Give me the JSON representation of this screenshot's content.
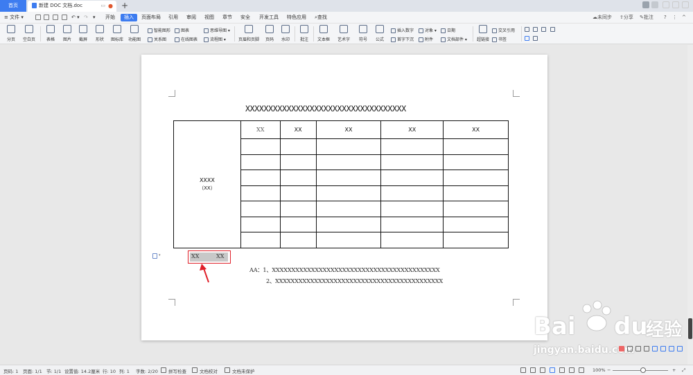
{
  "tabs": {
    "home": "首页",
    "doc": "新建 DOC 文档.doc",
    "add": "+"
  },
  "menu": {
    "file": "文件",
    "items": [
      "开始",
      "插入",
      "页面布局",
      "引用",
      "审阅",
      "视图",
      "章节",
      "安全",
      "开发工具",
      "特色应用"
    ],
    "search": "查找",
    "right": {
      "sync": "未同步",
      "share": "分享",
      "comment": "批注",
      "help": "?"
    }
  },
  "ribbon": {
    "large": [
      {
        "label": "分页",
        "icon": "page-break-icon"
      },
      {
        "label": "空白页",
        "icon": "blank-page-icon"
      },
      {
        "label": "表格",
        "icon": "table-icon"
      },
      {
        "label": "图片",
        "icon": "picture-icon"
      },
      {
        "label": "截屏",
        "icon": "screenshot-icon"
      },
      {
        "label": "形状",
        "icon": "shape-icon"
      },
      {
        "label": "图标库",
        "icon": "icon-library-icon"
      },
      {
        "label": "功能图",
        "icon": "function-chart-icon"
      },
      {
        "label": "页眉和页脚",
        "icon": "header-footer-icon"
      },
      {
        "label": "页码",
        "icon": "page-number-icon"
      },
      {
        "label": "水印",
        "icon": "watermark-icon"
      },
      {
        "label": "批注",
        "icon": "comment-icon"
      },
      {
        "label": "文本框",
        "icon": "textbox-icon"
      },
      {
        "label": "艺术字",
        "icon": "wordart-icon"
      },
      {
        "label": "符号",
        "icon": "symbol-icon"
      },
      {
        "label": "公式",
        "icon": "formula-icon"
      },
      {
        "label": "超链接",
        "icon": "hyperlink-icon"
      }
    ],
    "small": {
      "smart_art": "智能图形",
      "relation": "关系图",
      "chart": "图表",
      "online_chart": "在线图表",
      "mind_map": "思维导图",
      "flow_chart": "流程图",
      "insert_number": "插入数字",
      "drop_cap": "首字下沉",
      "object": "对象",
      "attachment": "附件",
      "date": "日期",
      "mail_merge": "文档部件",
      "cross_ref": "交叉引用",
      "bookmark": "书签"
    }
  },
  "document": {
    "title": "XXXXXXXXXXXXXXXXXXXXXXXXXXXXXXXXXXX",
    "table": {
      "merged_title": "XXXX",
      "merged_sub": "（XX）",
      "headers": [
        "XX",
        "XX",
        "XX",
        "XX",
        "XX"
      ],
      "empty_rows": 7
    },
    "selected_text": [
      "XX",
      "XX"
    ],
    "notes": {
      "line1": "AA：1、XXXXXXXXXXXXXXXXXXXXXXXXXXXXXXXXXXXXXXXXXXX",
      "line2": "2、XXXXXXXXXXXXXXXXXXXXXXXXXXXXXXXXXXXXXXXXXXX"
    }
  },
  "status": {
    "page": "页码: 1",
    "pages": "页面: 1/1",
    "section": "节: 1/1",
    "setting": "设置值: 14.2厘米",
    "row": "行: 10",
    "col": "列: 1",
    "words": "字数: 2/20",
    "spell": "拼写检查",
    "proof": "文档校对",
    "protect": "文档未保护",
    "zoom": "100%",
    "zoom_level": 0.55
  },
  "watermark": {
    "brand": "Bai",
    "brand2": "du",
    "cn": "经验",
    "url": "jingyan.baidu.com"
  },
  "colors": {
    "accent": "#3d7cf0",
    "selection_border": "#e0202a",
    "arrow": "#e0202a"
  }
}
